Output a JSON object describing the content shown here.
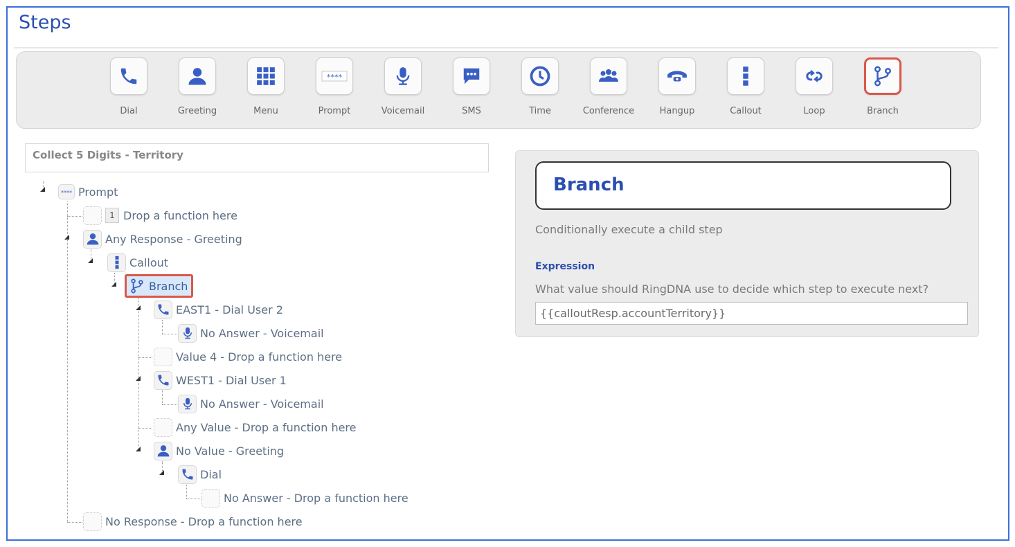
{
  "page": {
    "title": "Steps"
  },
  "toolbar": {
    "items": [
      {
        "label": "Dial",
        "icon": "phone-icon"
      },
      {
        "label": "Greeting",
        "icon": "user-icon"
      },
      {
        "label": "Menu",
        "icon": "grid-icon"
      },
      {
        "label": "Prompt",
        "icon": "asterisks-icon"
      },
      {
        "label": "Voicemail",
        "icon": "microphone-icon"
      },
      {
        "label": "SMS",
        "icon": "chat-bubble-icon"
      },
      {
        "label": "Time",
        "icon": "clock-icon"
      },
      {
        "label": "Conference",
        "icon": "group-icon"
      },
      {
        "label": "Hangup",
        "icon": "hangup-phone-icon"
      },
      {
        "label": "Callout",
        "icon": "vertical-dots-icon"
      },
      {
        "label": "Loop",
        "icon": "loop-icon"
      },
      {
        "label": "Branch",
        "icon": "branch-icon",
        "selected": true
      }
    ]
  },
  "tree": {
    "header": "Collect 5 Digits - Territory",
    "nodes": {
      "prompt": "Prompt",
      "digit_one_num": "1",
      "digit_one": "Drop a function here",
      "any_response": "Any Response - Greeting",
      "callout": "Callout",
      "branch": "Branch",
      "east1": "EAST1 - Dial User 2",
      "east1_no_answer": "No Answer - Voicemail",
      "value4": "Value 4 - Drop a function here",
      "west1": "WEST1 - Dial User 1",
      "west1_no_answer": "No Answer - Voicemail",
      "any_value": "Any Value - Drop a function here",
      "no_value": "No Value - Greeting",
      "dial": "Dial",
      "dial_no_answer": "No Answer - Drop a function here",
      "no_response": "No Response - Drop a function here"
    }
  },
  "panel": {
    "title": "Branch",
    "description": "Conditionally execute a child step",
    "expression_label": "Expression",
    "expression_help": "What value should RingDNA use to decide which step to execute next?",
    "expression_value": "{{calloutResp.accountTerritory}}"
  },
  "colors": {
    "accent": "#2b4fb0",
    "icon": "#3a5fc4",
    "selection": "#d9584a",
    "frame": "#3a6fd9"
  }
}
